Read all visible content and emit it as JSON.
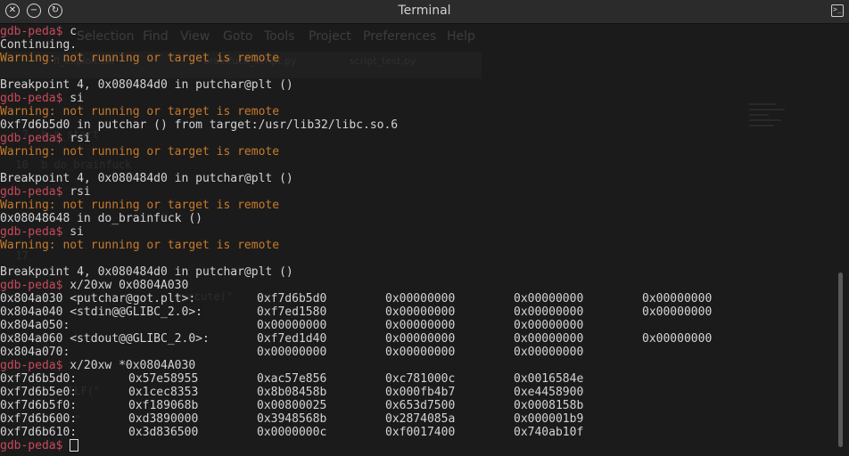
{
  "window": {
    "title": "Terminal"
  },
  "ghost_editor": {
    "menu": [
      "Selection",
      "Find",
      "View",
      "Goto",
      "Tools",
      "Project",
      "Preferences",
      "Help"
    ],
    "tabs": [
      "fl_exploit.txt",
      "brainfuck_script.py",
      "script_test.py"
    ],
    "code_lines": [
      "  7  b p_start",
      " 10  b do_brainfuck",
      " 17",
      "     execute(\"",
      "     ELF(\"",
      "  t = \""
    ]
  },
  "prompt": "gdb-peda$",
  "lines": [
    {
      "type": "cmd",
      "text": " c"
    },
    {
      "type": "out",
      "text": "Continuing."
    },
    {
      "type": "warn",
      "text": "Warning: not running or target is remote"
    },
    {
      "type": "out",
      "text": ""
    },
    {
      "type": "out",
      "text": "Breakpoint 4, 0x080484d0 in putchar@plt ()"
    },
    {
      "type": "cmd",
      "text": " si"
    },
    {
      "type": "warn",
      "text": "Warning: not running or target is remote"
    },
    {
      "type": "out",
      "text": "0xf7d6b5d0 in putchar () from target:/usr/lib32/libc.so.6"
    },
    {
      "type": "cmd",
      "text": " rsi"
    },
    {
      "type": "warn",
      "text": "Warning: not running or target is remote"
    },
    {
      "type": "out",
      "text": ""
    },
    {
      "type": "out",
      "text": "Breakpoint 4, 0x080484d0 in putchar@plt ()"
    },
    {
      "type": "cmd",
      "text": " rsi"
    },
    {
      "type": "warn",
      "text": "Warning: not running or target is remote"
    },
    {
      "type": "out",
      "text": "0x08048648 in do_brainfuck ()"
    },
    {
      "type": "cmd",
      "text": " si"
    },
    {
      "type": "warn",
      "text": "Warning: not running or target is remote"
    },
    {
      "type": "out",
      "text": ""
    },
    {
      "type": "out",
      "text": "Breakpoint 4, 0x080484d0 in putchar@plt ()"
    },
    {
      "type": "cmd",
      "text": " x/20xw 0x0804A030"
    },
    {
      "type": "row",
      "cells": [
        "0x804a030 <putchar@got.plt>:",
        "0xf7d6b5d0",
        "0x00000000",
        "0x00000000",
        "0x00000000"
      ]
    },
    {
      "type": "row",
      "cells": [
        "0x804a040 <stdin@@GLIBC_2.0>:",
        "0xf7ed1580",
        "0x00000000",
        "0x00000000",
        "0x00000000"
      ]
    },
    {
      "type": "row",
      "cells": [
        "0x804a050:",
        "0x00000000",
        "0x00000000",
        "0x00000000",
        ""
      ]
    },
    {
      "type": "row",
      "cells": [
        "0x804a060 <stdout@@GLIBC_2.0>:",
        "0xf7ed1d40",
        "0x00000000",
        "0x00000000",
        "0x00000000"
      ]
    },
    {
      "type": "row",
      "cells": [
        "0x804a070:",
        "0x00000000",
        "0x00000000",
        "0x00000000",
        ""
      ]
    },
    {
      "type": "cmd",
      "text": " x/20xw *0x0804A030"
    },
    {
      "type": "row2",
      "cells": [
        "0xf7d6b5d0:",
        "0x57e58955",
        "0xac57e856",
        "0xc781000c",
        "0x0016584e"
      ]
    },
    {
      "type": "row2",
      "cells": [
        "0xf7d6b5e0:",
        "0x1cec8353",
        "0x8b08458b",
        "0x000fb4b7",
        "0xe4458900"
      ]
    },
    {
      "type": "row2",
      "cells": [
        "0xf7d6b5f0:",
        "0xf189068b",
        "0x00800025",
        "0x653d7500",
        "0x0008158b"
      ]
    },
    {
      "type": "row2",
      "cells": [
        "0xf7d6b600:",
        "0xd3890000",
        "0x3948568b",
        "0x2874085a",
        "0x000001b9"
      ]
    },
    {
      "type": "row2",
      "cells": [
        "0xf7d6b610:",
        "0x3d836500",
        "0x0000000c",
        "0xf0017400",
        "0x740ab10f"
      ]
    },
    {
      "type": "cursor",
      "text": " "
    }
  ]
}
